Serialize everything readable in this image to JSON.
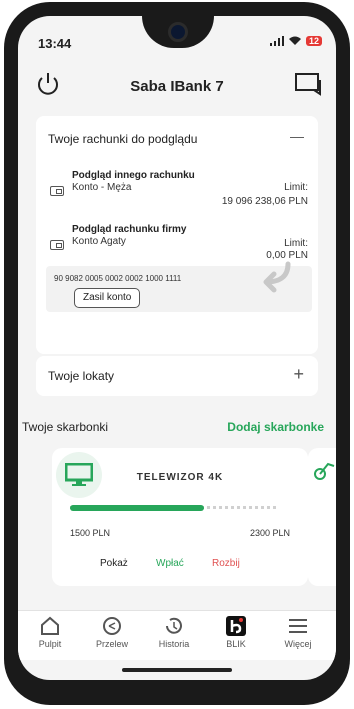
{
  "status": {
    "time": "13:44",
    "signal": "signal-icon",
    "wifi": "wifi-icon",
    "battery": "12"
  },
  "header": {
    "title": "Saba IBank 7"
  },
  "accounts": {
    "heading": "Twoje rachunki do podglądu",
    "toggle": "—",
    "items": [
      {
        "title": "Podgląd innego rachunku",
        "subtitle": "Konto - Męża",
        "limit_label": "Limit:",
        "limit_value": "19 096 238,06 PLN"
      },
      {
        "title": "Podgląd rachunku firmy",
        "subtitle": "Konto Agaty",
        "limit_label": "Limit:",
        "limit_value": "0,00 PLN"
      }
    ],
    "iban": "90 9082 0005 0002 0002 1000 1111",
    "topup_label": "Zasil konto"
  },
  "deposits": {
    "heading": "Twoje lokaty",
    "toggle": "+"
  },
  "piggybanks": {
    "heading": "Twoje skarbonki",
    "add_label": "Dodaj skarbonke",
    "items": [
      {
        "name": "TELEWIZOR 4K",
        "current": "1500 PLN",
        "target": "2300 PLN",
        "progress": 0.652,
        "actions": [
          "Pokaż",
          "Wpłać",
          "Rozbij"
        ]
      }
    ],
    "colors": {
      "accent": "#27a65a",
      "danger": "#e05252"
    }
  },
  "nav": [
    {
      "label": "Pulpit",
      "icon": "home-icon"
    },
    {
      "label": "Przelew",
      "icon": "transfer-icon"
    },
    {
      "label": "Historia",
      "icon": "history-icon"
    },
    {
      "label": "BLIK",
      "icon": "blik-icon"
    },
    {
      "label": "Więcej",
      "icon": "menu-icon"
    }
  ]
}
